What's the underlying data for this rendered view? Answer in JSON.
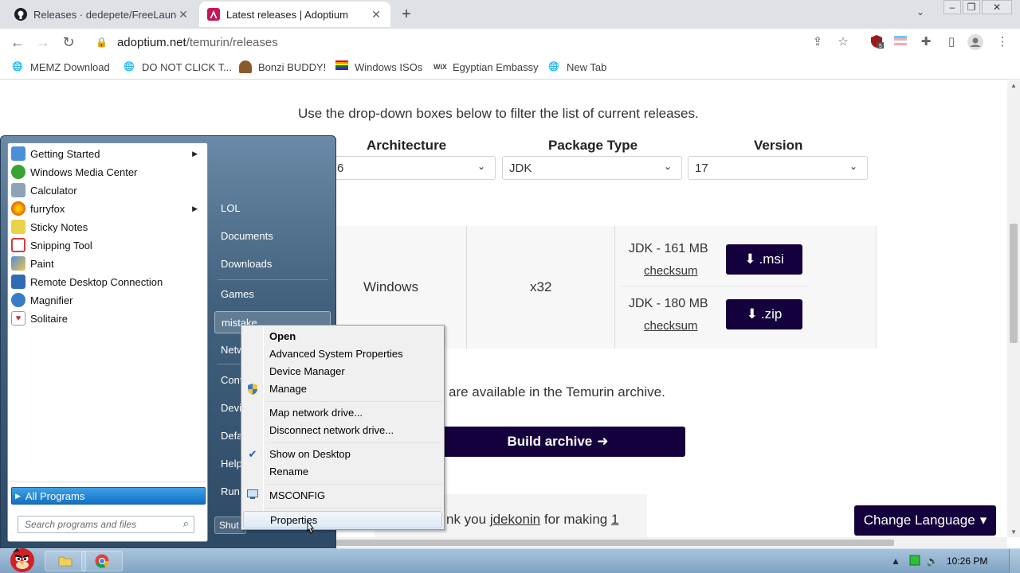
{
  "browser": {
    "tabs": [
      {
        "title": "Releases · dedepete/FreeLaunc",
        "icon": "github-icon"
      },
      {
        "title": "Latest releases | Adoptium",
        "icon": "adoptium-icon"
      }
    ],
    "address": {
      "host": "adoptium.net",
      "path": "/temurin/releases"
    },
    "bookmarks": [
      {
        "label": "MEMZ Download",
        "icon": "globe-icon"
      },
      {
        "label": "DO NOT CLICK T...",
        "icon": "globe-icon"
      },
      {
        "label": "Bonzi BUDDY!",
        "icon": "bonzi-icon"
      },
      {
        "label": "Windows ISOs",
        "icon": "rainbow-flag-icon"
      },
      {
        "label": "Egyptian Embassy",
        "icon": "wix-icon"
      },
      {
        "label": "New Tab",
        "icon": "globe-icon"
      }
    ],
    "extension_badge": "5"
  },
  "page": {
    "filter_text": "Use the drop-down boxes below to filter the list of current releases.",
    "headers": {
      "architecture": "Architecture",
      "package_type": "Package Type",
      "version": "Version"
    },
    "dropdowns": {
      "architecture": "6",
      "package_type": "JDK",
      "version": "17"
    },
    "release": {
      "os": "Windows",
      "arch": "x32",
      "packages": [
        {
          "size": "JDK - 161 MB",
          "checksum": "checksum",
          "button": ".msi"
        },
        {
          "size": "JDK - 180 MB",
          "checksum": "checksum",
          "button": ".zip"
        }
      ]
    },
    "archive_text": "are available in the Temurin archive.",
    "build_archive": "Build archive",
    "thanks": {
      "prefix": "nk you ",
      "user": "jdekonin",
      "middle": " for making ",
      "count": "1"
    },
    "change_language": "Change Language"
  },
  "start_menu": {
    "programs": [
      {
        "label": "Getting Started",
        "has_arrow": true,
        "color": "#4a90d9"
      },
      {
        "label": "Windows Media Center",
        "has_arrow": false,
        "color": "#3aa335"
      },
      {
        "label": "Calculator",
        "has_arrow": false,
        "color": "#8ea3b8"
      },
      {
        "label": "furryfox",
        "has_arrow": true,
        "color": "#e66000"
      },
      {
        "label": "Sticky Notes",
        "has_arrow": false,
        "color": "#e8d34a"
      },
      {
        "label": "Snipping Tool",
        "has_arrow": false,
        "color": "#d33d3d"
      },
      {
        "label": "Paint",
        "has_arrow": false,
        "color": "#4f8fd8"
      },
      {
        "label": "Remote Desktop Connection",
        "has_arrow": false,
        "color": "#2f6cb3"
      },
      {
        "label": "Magnifier",
        "has_arrow": false,
        "color": "#3a7bc8"
      },
      {
        "label": "Solitaire",
        "has_arrow": false,
        "color": "#c33"
      }
    ],
    "all_programs": "All Programs",
    "search_placeholder": "Search programs and files",
    "right_items": [
      "LOL",
      "Documents",
      "Downloads",
      "Games",
      "mistake",
      "Netw",
      "Cont",
      "Devi",
      "Defa",
      "Help",
      "Run..."
    ],
    "shutdown": "Shut"
  },
  "context_menu": {
    "items": [
      "Open",
      "Advanced System Properties",
      "Device Manager",
      "Manage",
      "Map network drive...",
      "Disconnect network drive...",
      "Show on Desktop",
      "Rename",
      "MSCONFIG",
      "Properties"
    ]
  },
  "taskbar": {
    "clock": "10:26 PM"
  }
}
